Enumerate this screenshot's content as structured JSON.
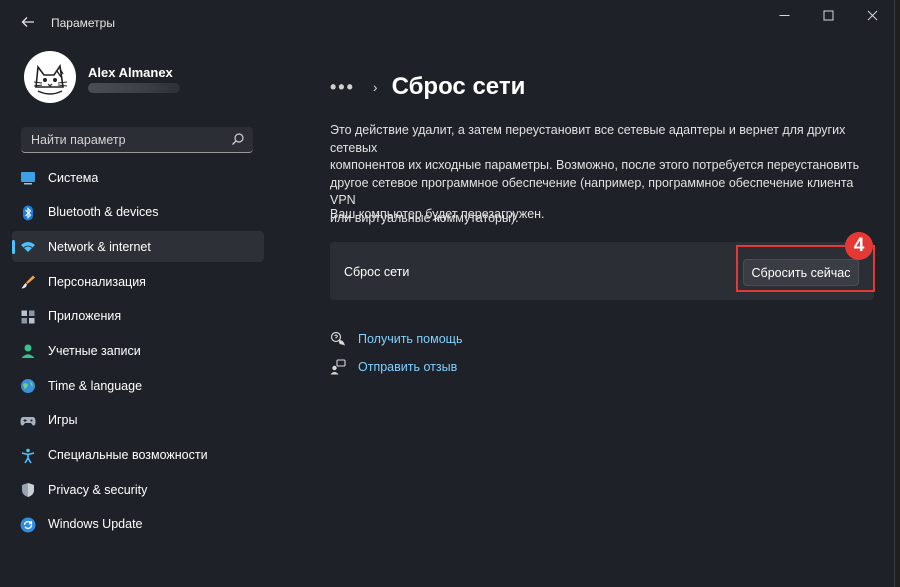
{
  "app": {
    "title": "Параметры",
    "accent": "#4cc2ff",
    "annotation_color": "#e53935"
  },
  "window_controls": [
    "minimize-icon",
    "maximize-icon",
    "close-icon"
  ],
  "user": {
    "name": "Alex Almanex",
    "avatar_icon": "cat-avatar-icon"
  },
  "search": {
    "placeholder": "Найти параметр",
    "icon": "search-icon"
  },
  "sidebar": {
    "items": [
      {
        "label": "Система",
        "icon": "system-icon",
        "active": false
      },
      {
        "label": "Bluetooth & devices",
        "icon": "bluetooth-icon",
        "active": false
      },
      {
        "label": "Network & internet",
        "icon": "network-icon",
        "active": true
      },
      {
        "label": "Персонализация",
        "icon": "brush-icon",
        "active": false
      },
      {
        "label": "Приложения",
        "icon": "apps-icon",
        "active": false
      },
      {
        "label": "Учетные записи",
        "icon": "accounts-icon",
        "active": false
      },
      {
        "label": "Time & language",
        "icon": "globe-icon",
        "active": false
      },
      {
        "label": "Игры",
        "icon": "gamepad-icon",
        "active": false
      },
      {
        "label": "Специальные возможности",
        "icon": "accessibility-icon",
        "active": false
      },
      {
        "label": "Privacy & security",
        "icon": "shield-icon",
        "active": false
      },
      {
        "label": "Windows Update",
        "icon": "update-icon",
        "active": false
      }
    ]
  },
  "main": {
    "breadcrumb_more": "•••",
    "breadcrumb_sep": "›",
    "title": "Сброс сети",
    "description": [
      "Это действие удалит, а затем переустановит все сетевые адаптеры и вернет для других сетевых",
      "компонентов их исходные параметры. Возможно, после этого потребуется переустановить",
      "другое сетевое программное обеспечение (например, программное обеспечение клиента VPN",
      "или виртуальные коммутаторы)."
    ],
    "restart_note": "Ваш компьютер будет перезагружен.",
    "reset_card": {
      "label": "Сброс сети",
      "button": "Сбросить сейчас"
    },
    "step_badge": "4",
    "links": [
      {
        "label": "Получить помощь",
        "icon": "help-icon"
      },
      {
        "label": "Отправить отзыв",
        "icon": "feedback-icon"
      }
    ]
  }
}
